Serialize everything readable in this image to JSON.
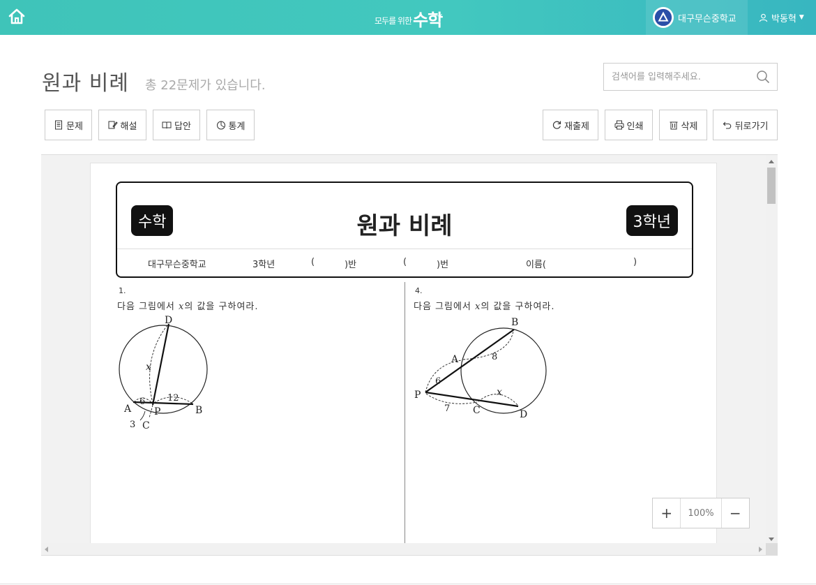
{
  "header": {
    "logo_small": "모두를 위한",
    "logo_big": "수학",
    "logo_sup": "+-x",
    "school_name": "대구무슨중학교",
    "user_name": "박동혁"
  },
  "page": {
    "title": "원과 비례",
    "subtitle": "총 22문제가 있습니다.",
    "search_placeholder": "검색어를 입력해주세요."
  },
  "toolbar_left": [
    {
      "label": "문제",
      "icon": "document-icon"
    },
    {
      "label": "해설",
      "icon": "edit-icon"
    },
    {
      "label": "답안",
      "icon": "book-icon"
    },
    {
      "label": "통계",
      "icon": "pie-chart-icon"
    }
  ],
  "toolbar_right": [
    {
      "label": "재출제",
      "icon": "refresh-icon"
    },
    {
      "label": "인쇄",
      "icon": "print-icon"
    },
    {
      "label": "삭제",
      "icon": "trash-icon"
    },
    {
      "label": "뒤로가기",
      "icon": "back-icon"
    }
  ],
  "worksheet": {
    "subject_tag": "수학",
    "grade_tag": "3학년",
    "title": "원과 비례",
    "info": {
      "school": "대구무슨중학교",
      "grade": "3학년",
      "class_open": "(",
      "class_close": ")반",
      "number_open": "(",
      "number_close": ")번",
      "name_open": "이름(",
      "name_close": ")"
    },
    "questions": [
      {
        "number": "1.",
        "text_before": "다음 그림에서 ",
        "variable": "x",
        "text_after": "의 값을 구하여라.",
        "labels": {
          "D": "D",
          "x": "x",
          "A": "A",
          "six": "6",
          "P": "P",
          "twelve": "12",
          "B": "B",
          "three": "3",
          "C": "C"
        }
      },
      {
        "number": "4.",
        "text_before": "다음 그림에서 ",
        "variable": "x",
        "text_after": "의 값을 구하여라.",
        "labels": {
          "B": "B",
          "A": "A",
          "eight": "8",
          "six": "6",
          "P": "P",
          "seven": "7",
          "x": "x",
          "C": "C",
          "D": "D"
        }
      }
    ]
  },
  "zoom": {
    "plus": "+",
    "value": "100%",
    "minus": "−"
  },
  "colors": {
    "topbar": "#3fc4b9",
    "paper": "#ffffff",
    "viewer_bg": "#f2f2f2"
  }
}
